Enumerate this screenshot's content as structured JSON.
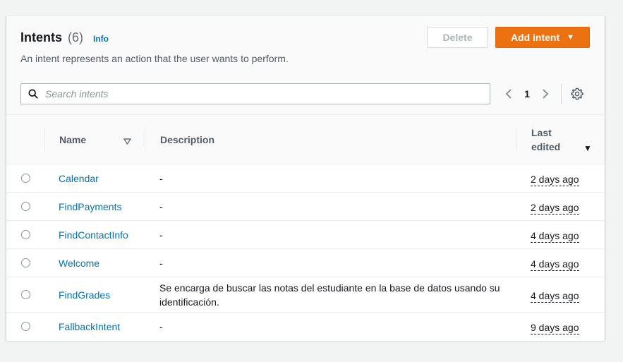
{
  "header": {
    "title": "Intents",
    "count": "(6)",
    "info": "Info",
    "description": "An intent represents an action that the user wants to perform.",
    "delete_label": "Delete",
    "add_label": "Add intent"
  },
  "search": {
    "placeholder": "Search intents",
    "value": ""
  },
  "pagination": {
    "current_page": "1"
  },
  "table": {
    "columns": {
      "name": "Name",
      "description": "Description",
      "last_edited_line1": "Last",
      "last_edited_line2": "edited"
    },
    "rows": [
      {
        "name": "Calendar",
        "description": "-",
        "last_edited": "2 days ago"
      },
      {
        "name": "FindPayments",
        "description": "-",
        "last_edited": "2 days ago"
      },
      {
        "name": "FindContactInfo",
        "description": "-",
        "last_edited": "4 days ago"
      },
      {
        "name": "Welcome",
        "description": "-",
        "last_edited": "4 days ago"
      },
      {
        "name": "FindGrades",
        "description": "Se encarga de buscar las notas del estudiante en la base de datos usando su identificación.",
        "last_edited": "4 days ago"
      },
      {
        "name": "FallbackIntent",
        "description": "-",
        "last_edited": "9 days ago"
      }
    ]
  },
  "colors": {
    "primary": "#ec7211",
    "link": "#0073bb",
    "background": "#f2f3f3"
  },
  "icons": {
    "search": "search-icon",
    "prev": "chevron-left-icon",
    "next": "chevron-right-icon",
    "settings": "gear-icon",
    "sort": "caret-down-icon"
  }
}
